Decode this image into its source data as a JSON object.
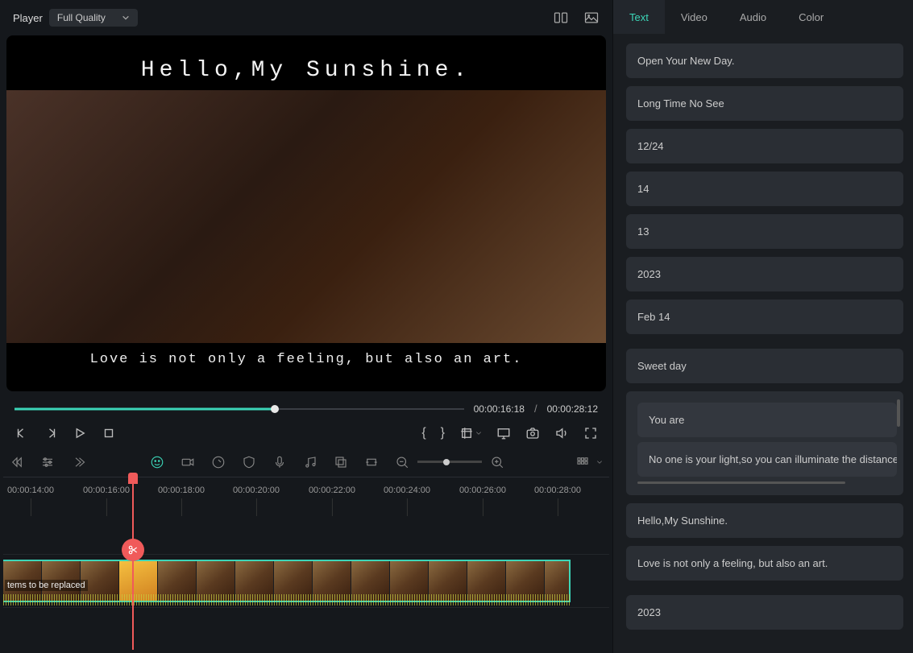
{
  "player": {
    "label": "Player",
    "quality": "Full Quality"
  },
  "preview": {
    "title": "Hello,My Sunshine.",
    "subtitle": "Love is not only a feeling, but also an art."
  },
  "playback": {
    "currentTime": "00:00:16:18",
    "duration": "00:00:28:12"
  },
  "timeline": {
    "ticks": [
      "00:00:14:00",
      "00:00:16:00",
      "00:00:18:00",
      "00:00:20:00",
      "00:00:22:00",
      "00:00:24:00",
      "00:00:26:00",
      "00:00:28:00"
    ],
    "clipLabel": "tems to be replaced"
  },
  "tabs": {
    "text": "Text",
    "video": "Video",
    "audio": "Audio",
    "color": "Color"
  },
  "textItems": {
    "card1": "Open Your New Day.",
    "card2": "Long Time No See",
    "card3": "12/24",
    "card4": "14",
    "card5": "13",
    "card6": "2023",
    "card7": "Feb 14",
    "card8": "Sweet day",
    "g1a": "You are",
    "g1b": "No one is your light,so you can illuminate the distance yours",
    "card9": "Hello,My Sunshine.",
    "card10": " Love is not only a feeling, but also an art.",
    "card11": "2023"
  }
}
